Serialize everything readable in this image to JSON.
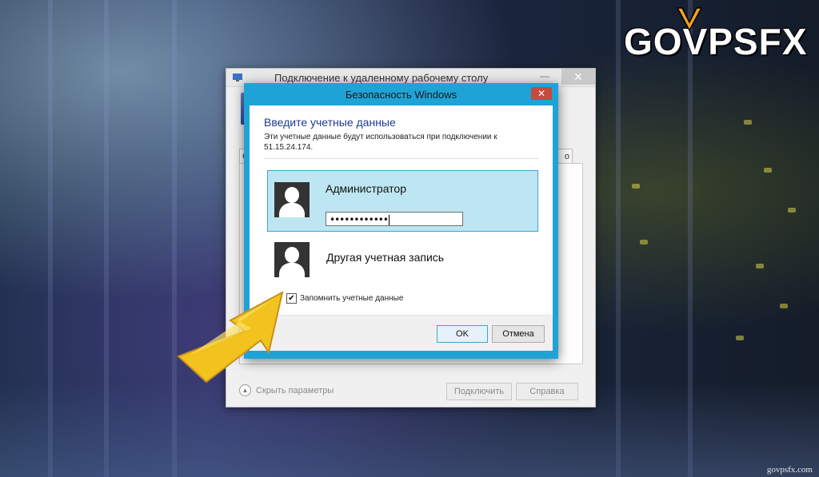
{
  "brand": {
    "logo_text": "GOVPSFX",
    "footer_url": "govpsfx.com",
    "accent": "#f2c21f"
  },
  "rdp_window": {
    "title": "Подключение к удаленному рабочему столу",
    "close_glyph": "✕",
    "tab_left": "Об",
    "tab_right": "о",
    "hide_params_label": "Скрыть параметры",
    "connect_button": "Подключить",
    "help_button": "Справка"
  },
  "security_dialog": {
    "title": "Безопасность Windows",
    "close_glyph": "✕",
    "heading": "Введите учетные данные",
    "description": "Эти учетные данные будут использоваться при подключении к 51.15.24.174.",
    "accounts": [
      {
        "name": "Администратор",
        "password_mask": "••••••••••••",
        "selected": true
      },
      {
        "name": "Другая учетная запись",
        "selected": false
      }
    ],
    "remember_label": "Запомнить учетные данные",
    "remember_checked": true,
    "ok_button": "OK",
    "cancel_button": "Отмена",
    "frame_color": "#1fa3d6",
    "heading_color": "#1e3a8f"
  }
}
